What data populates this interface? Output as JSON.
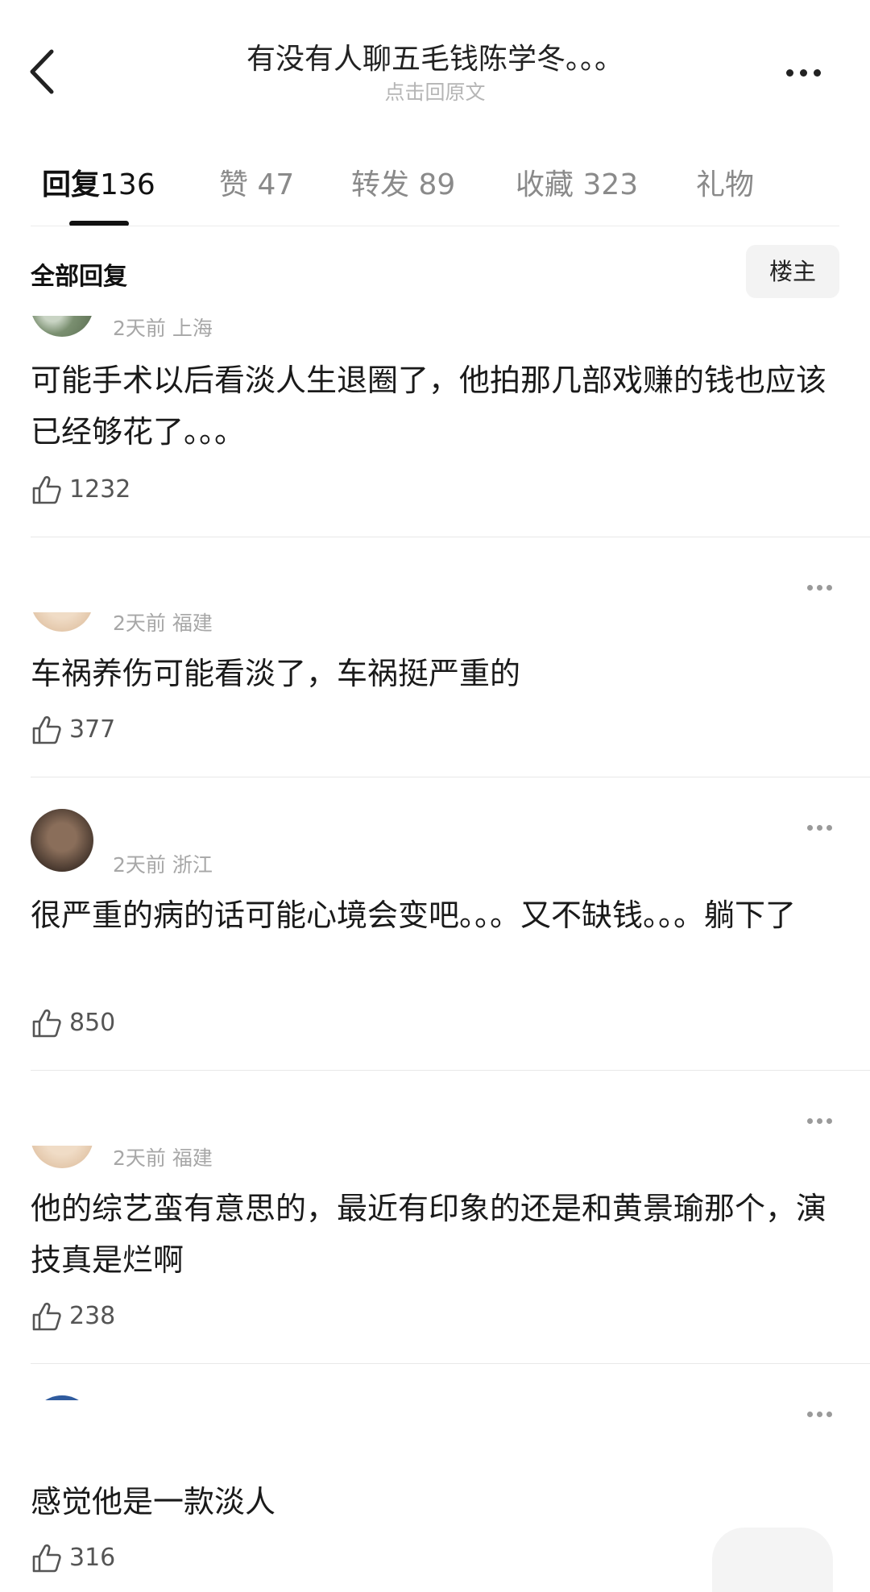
{
  "header": {
    "title": "有没有人聊五毛钱陈学冬。。。",
    "subtitle": "点击回原文",
    "back_icon": "chevron-left-icon",
    "more_icon": "more-horizontal-icon"
  },
  "tabs": [
    {
      "label": "回复",
      "count": "136",
      "active": true
    },
    {
      "label": "赞",
      "count": "47",
      "active": false
    },
    {
      "label": "转发",
      "count": "89",
      "active": false
    },
    {
      "label": "收藏",
      "count": "323",
      "active": false
    },
    {
      "label": "礼物",
      "count": "",
      "active": false
    }
  ],
  "replies_header": {
    "label": "全部回复",
    "op_button": "楼主"
  },
  "comments": [
    {
      "meta": "2天前 上海",
      "text": "可能手术以后看淡人生退圈了，他拍那几部戏赚的钱也应该已经够花了。。。",
      "likes": "1232",
      "avatar_color": "#7a8f70"
    },
    {
      "meta": "2天前 福建",
      "text": "车祸养伤可能看淡了，车祸挺严重的",
      "likes": "377",
      "avatar_color": "#e2c2a2"
    },
    {
      "meta": "2天前 浙江",
      "text": "很严重的病的话可能心境会变吧。。。又不缺钱。。。躺下了",
      "likes": "850",
      "avatar_color": "#5a4638"
    },
    {
      "meta": "2天前 福建",
      "text": "他的综艺蛮有意思的，最近有印象的还是和黄景瑜那个，演技真是烂啊",
      "likes": "238",
      "avatar_color": "#e2c2a2"
    },
    {
      "meta": "",
      "text": "感觉他是一款淡人",
      "likes": "316",
      "avatar_color": "#2f5b9e"
    }
  ],
  "colors": {
    "primary_text": "#1a1a1a",
    "secondary_text": "#a7a7a7",
    "tab_inactive": "#8a8a8a",
    "divider": "#e8e8e8"
  }
}
